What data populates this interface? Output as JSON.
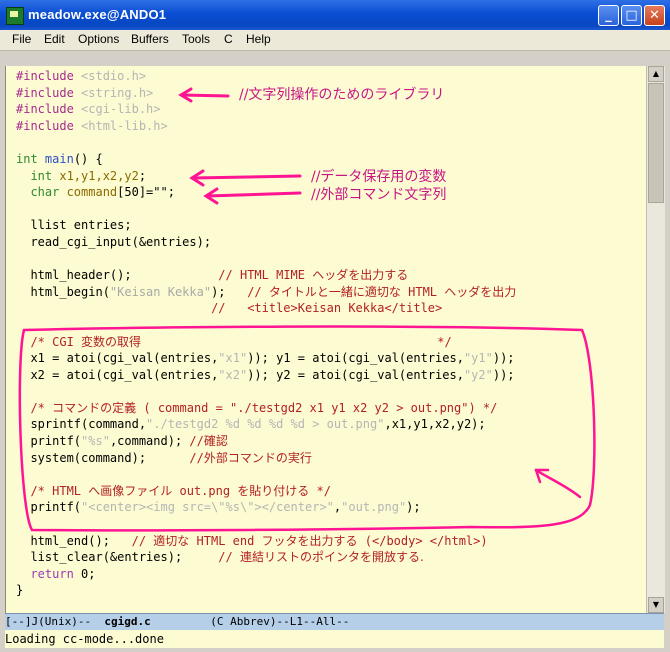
{
  "window": {
    "title": "meadow.exe@ANDO1",
    "min_label": "_",
    "max_label": "□",
    "close_label": "✕"
  },
  "menu": [
    "File",
    "Edit",
    "Options",
    "Buffers",
    "Tools",
    "C",
    "Help"
  ],
  "code": {
    "inc1_dir": "#include",
    "inc1_file": " <stdio.h>",
    "inc2_dir": "#include",
    "inc2_file": " <string.h>",
    "inc3_dir": "#include",
    "inc3_file": " <cgi-lib.h>",
    "inc4_dir": "#include",
    "inc4_file": " <html-lib.h>",
    "main_type": "int",
    "main_name": " main",
    "main_rest": "() {",
    "int_kw": "  int",
    "int_vars": " x1,y1,x2,y2",
    "int_end": ";",
    "char_kw": "  char",
    "char_var": " command",
    "char_rest": "[50]=\"\";",
    "llist": "  llist entries;",
    "readcgi": "  read_cgi_input(&entries);",
    "hh_call": "  html_header();            ",
    "hh_comment_a": "// HTML MIME ",
    "hh_comment_b": "ヘッダを出力する",
    "hb_call": "  html_begin(",
    "hb_str": "\"Keisan Kekka\"",
    "hb_end": ");   ",
    "hb_comment_a": "// ",
    "hb_comment_b": "タイトルと一緒に適切な",
    "hb_comment_c": " HTML ",
    "hb_comment_d": "ヘッダを出力",
    "title_comment": "                           //   <title>Keisan Kekka</title>",
    "cgi_comment_a": "  /* CGI ",
    "cgi_comment_b": "変数の取得",
    "cgi_comment_c": "                                         */",
    "x1_line_a": "  x1 = atoi(cgi_val(entries,",
    "x1_line_s1": "\"x1\"",
    "x1_line_b": ")); y1 = atoi(cgi_val(entries,",
    "x1_line_s2": "\"y1\"",
    "x1_line_c": "));",
    "x2_line_a": "  x2 = atoi(cgi_val(entries,",
    "x2_line_s1": "\"x2\"",
    "x2_line_b": ")); y2 = atoi(cgi_val(entries,",
    "x2_line_s2": "\"y2\"",
    "x2_line_c": "));",
    "cmd_comment_a": "  /* ",
    "cmd_comment_b": "コマンドの定義",
    "cmd_comment_c": " ( command = \"./testgd2 x1 y1 x2 y2 > out.png\") */",
    "sprintf_a": "  sprintf(command,",
    "sprintf_s": "\"./testgd2 %d %d %d %d > out.png\"",
    "sprintf_b": ",x1,y1,x2,y2);",
    "printf_a": "  printf(",
    "printf_s": "\"%s\"",
    "printf_b": ",command); ",
    "printf_c": "//",
    "printf_d": "確認",
    "system_a": "  system(command);      ",
    "system_b": "//",
    "system_c": "外部コマンドの実行",
    "html_comment_a": "  /* HTML ",
    "html_comment_b": "へ画像ファイル",
    "html_comment_c": " out.png ",
    "html_comment_d": "を貼り付ける",
    "html_comment_e": " */",
    "printf2_a": "  printf(",
    "printf2_s": "\"<center><img src=\\\"%s\\\"></center>\"",
    "printf2_b": ",",
    "printf2_s2": "\"out.png\"",
    "printf2_c": ");",
    "end_call": "  html_end();   ",
    "end_comment_a": "// ",
    "end_comment_b": "適切な",
    "end_comment_c": " HTML end ",
    "end_comment_d": "フッタを出力する",
    "end_comment_e": " (</body> </html>)",
    "clear_call": "  list_clear(&entries);     ",
    "clear_comment_a": "// ",
    "clear_comment_b": "連結リストのポインタを開放する.",
    "return_kw": "  return",
    "return_rest": " 0;",
    "close_brace": "}"
  },
  "notes": {
    "include_note": "//文字列操作のためのライブラリ",
    "int_note": "//データ保存用の変数",
    "char_note": "//外部コマンド文字列"
  },
  "modeline": {
    "left": "[--]J(Unix)--  ",
    "buffer": "cgigd.c",
    "right": "         (C Abbrev)--L1--All--"
  },
  "minibuffer": "Loading cc-mode...done",
  "colors": {
    "annotation": "#ff1493",
    "background": "#fdfbd2"
  }
}
